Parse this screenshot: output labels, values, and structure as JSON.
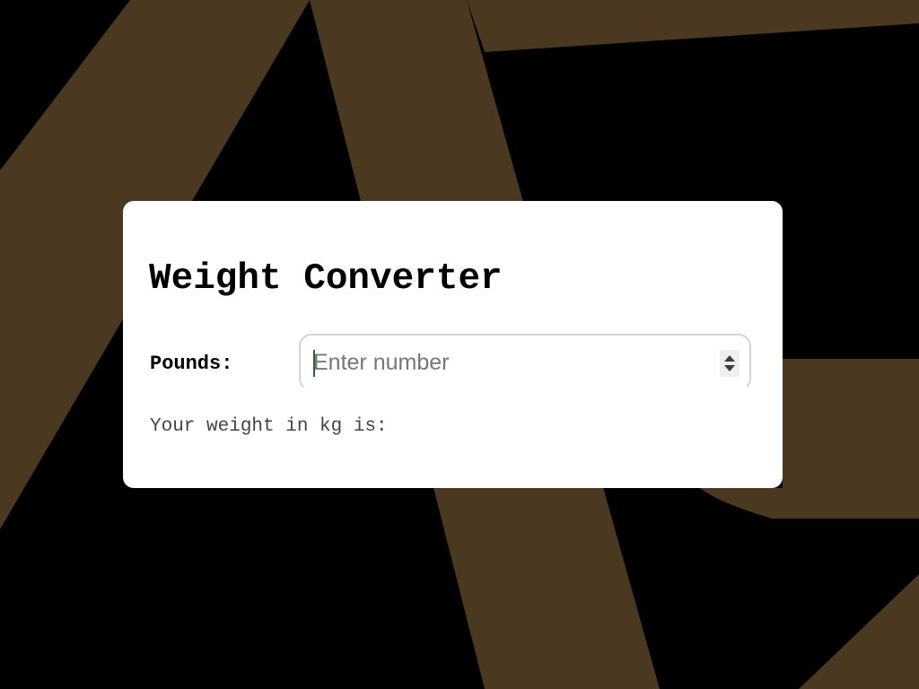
{
  "page": {
    "background_color": "#000000",
    "art_color": "#4a3820"
  },
  "converter": {
    "title": "Weight Converter",
    "pounds_label": "Pounds:",
    "pounds_input": {
      "value": "",
      "placeholder": "Enter number"
    },
    "spinner_icon": "spin-up-down-icon",
    "result_text": "Your weight in kg is:"
  }
}
